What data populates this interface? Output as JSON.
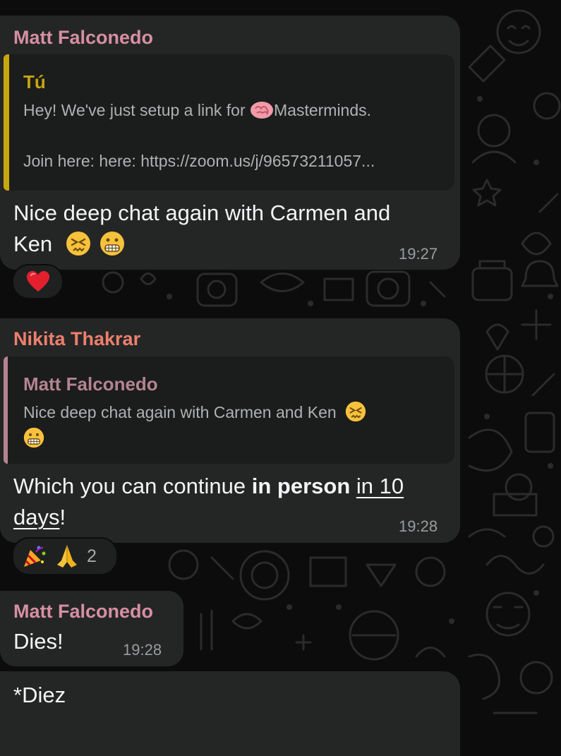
{
  "colors": {
    "background": "#0c0c0c",
    "bubble": "#242626",
    "quote_bg": "#1b1c1c",
    "sender_matt": "#d68fa3",
    "sender_nikita": "#ef7f6d",
    "quote_tu": "#c5a70f",
    "quote_matt": "#b48491",
    "timestamp": "#999da0"
  },
  "messages": [
    {
      "sender": "Matt Falconedo",
      "quote": {
        "name": "Tú",
        "line1_before": "Hey! We've just setup a link for ",
        "line1_icon": "brain-emoji",
        "line1_after": "Masterminds.",
        "line2": "Join here:  here: https://zoom.us/j/96573211057..."
      },
      "text_line1": "Nice deep chat again with Carmen and",
      "text_line2": "Ken",
      "emojis": [
        "persevering-face-emoji",
        "grimacing-face-emoji"
      ],
      "time": "19:27",
      "reaction": {
        "emoji": "red-heart-emoji"
      }
    },
    {
      "sender": "Nikita Thakrar",
      "quote": {
        "name": "Matt Falconedo",
        "line1": "Nice deep chat again with Carmen and Ken",
        "line1_icon": "persevering-face-emoji",
        "line2_icon": "grimacing-face-emoji"
      },
      "text_part1": "Which you can continue ",
      "text_bold": "in person",
      "text_space": " ",
      "text_link1": "in 10",
      "text_link2": "days",
      "text_end": "!",
      "time": "19:28",
      "reaction": {
        "emojis": [
          "party-popper-emoji",
          "folded-hands-emoji"
        ],
        "count": "2"
      }
    },
    {
      "sender": "Matt Falconedo",
      "text": "Dies!",
      "time": "19:28"
    },
    {
      "text": "*Diez"
    }
  ]
}
